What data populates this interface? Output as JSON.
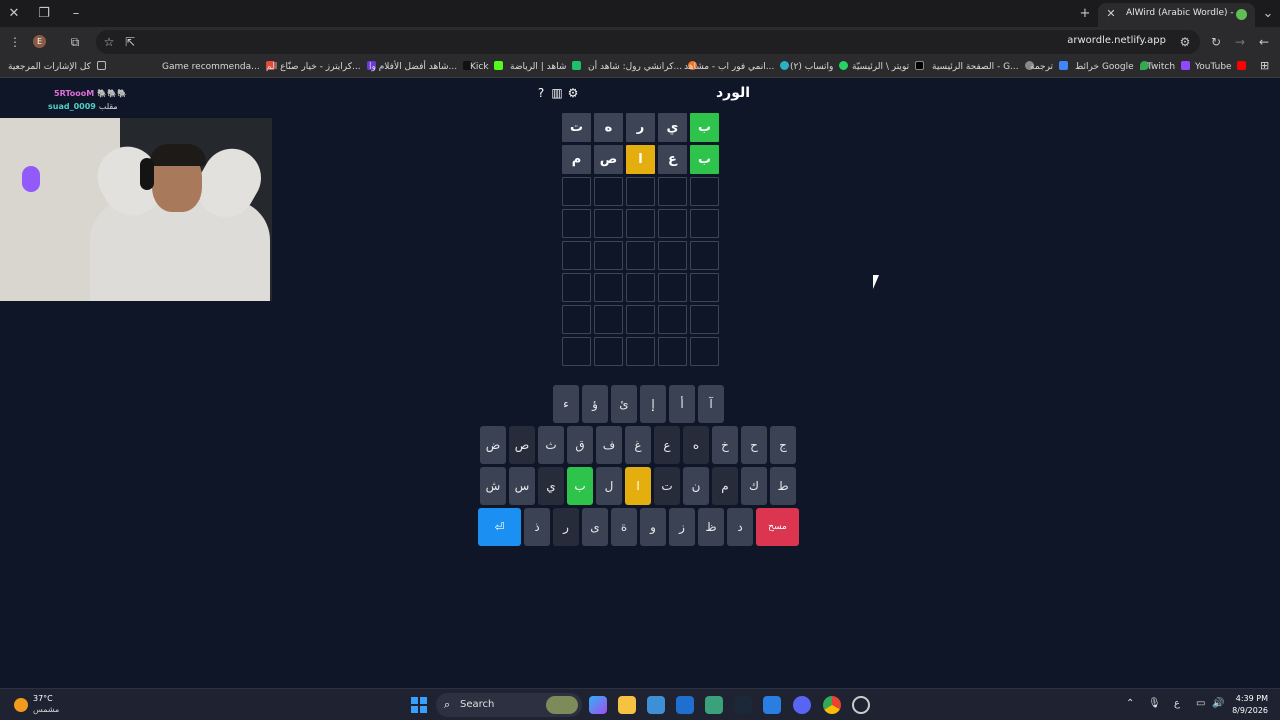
{
  "browser": {
    "tab_title": "AlWird (Arabic Wordle) - الورد",
    "url": "arwordle.netlify.app",
    "profile_initial": "E",
    "bookmarks": [
      "YouTube",
      "Twitch",
      "خرائط Google",
      "ترجمة",
      "الصفحة الرئيسية - G...",
      "تويتر \\ الرئيسيّة",
      "واتساب (٢)",
      "انمي فور اب - مشاهد...",
      "كرانشي رول: شاهد أن...",
      "شاهد | الرياضة",
      "Kick",
      "شاهد أفضل الأفلام وا...",
      "كرايترز - خيار صنّاع الم...",
      "Game recommenda...",
      "كل الإشارات المرجعية"
    ]
  },
  "stream": {
    "chat": [
      {
        "user": "5RToooM",
        "badges": "🐘🐘🐘"
      },
      {
        "user": "suad_0009",
        "tag": "مقلب"
      }
    ]
  },
  "game": {
    "title": "الورد",
    "board": [
      [
        {
          "l": "ب",
          "s": "correct"
        },
        {
          "l": "ي",
          "s": "absent"
        },
        {
          "l": "ر",
          "s": "absent"
        },
        {
          "l": "ه",
          "s": "absent"
        },
        {
          "l": "ت",
          "s": "absent"
        }
      ],
      [
        {
          "l": "ب",
          "s": "correct"
        },
        {
          "l": "ع",
          "s": "absent"
        },
        {
          "l": "ا",
          "s": "present"
        },
        {
          "l": "ص",
          "s": "absent"
        },
        {
          "l": "م",
          "s": "absent"
        }
      ],
      [
        {
          "l": "",
          "s": "empty"
        },
        {
          "l": "",
          "s": "empty"
        },
        {
          "l": "",
          "s": "empty"
        },
        {
          "l": "",
          "s": "empty"
        },
        {
          "l": "",
          "s": "empty"
        }
      ],
      [
        {
          "l": "",
          "s": "empty"
        },
        {
          "l": "",
          "s": "empty"
        },
        {
          "l": "",
          "s": "empty"
        },
        {
          "l": "",
          "s": "empty"
        },
        {
          "l": "",
          "s": "empty"
        }
      ],
      [
        {
          "l": "",
          "s": "empty"
        },
        {
          "l": "",
          "s": "empty"
        },
        {
          "l": "",
          "s": "empty"
        },
        {
          "l": "",
          "s": "empty"
        },
        {
          "l": "",
          "s": "empty"
        }
      ],
      [
        {
          "l": "",
          "s": "empty"
        },
        {
          "l": "",
          "s": "empty"
        },
        {
          "l": "",
          "s": "empty"
        },
        {
          "l": "",
          "s": "empty"
        },
        {
          "l": "",
          "s": "empty"
        }
      ],
      [
        {
          "l": "",
          "s": "empty"
        },
        {
          "l": "",
          "s": "empty"
        },
        {
          "l": "",
          "s": "empty"
        },
        {
          "l": "",
          "s": "empty"
        },
        {
          "l": "",
          "s": "empty"
        }
      ],
      [
        {
          "l": "",
          "s": "empty"
        },
        {
          "l": "",
          "s": "empty"
        },
        {
          "l": "",
          "s": "empty"
        },
        {
          "l": "",
          "s": "empty"
        },
        {
          "l": "",
          "s": "empty"
        }
      ]
    ],
    "keyboard": [
      [
        {
          "k": "آ"
        },
        {
          "k": "أ"
        },
        {
          "k": "إ"
        },
        {
          "k": "ئ"
        },
        {
          "k": "ؤ"
        },
        {
          "k": "ء"
        }
      ],
      [
        {
          "k": "ج"
        },
        {
          "k": "ح"
        },
        {
          "k": "خ"
        },
        {
          "k": "ه",
          "s": "used"
        },
        {
          "k": "ع",
          "s": "used"
        },
        {
          "k": "غ"
        },
        {
          "k": "ف"
        },
        {
          "k": "ق"
        },
        {
          "k": "ث"
        },
        {
          "k": "ص",
          "s": "used"
        },
        {
          "k": "ض"
        }
      ],
      [
        {
          "k": "ط"
        },
        {
          "k": "ك"
        },
        {
          "k": "م",
          "s": "used"
        },
        {
          "k": "ن"
        },
        {
          "k": "ت",
          "s": "used"
        },
        {
          "k": "ا",
          "s": "present"
        },
        {
          "k": "ل"
        },
        {
          "k": "ب",
          "s": "correct"
        },
        {
          "k": "ي",
          "s": "used"
        },
        {
          "k": "س"
        },
        {
          "k": "ش"
        }
      ],
      [
        {
          "k": "مسح",
          "s": "delete"
        },
        {
          "k": "د"
        },
        {
          "k": "ظ"
        },
        {
          "k": "ز"
        },
        {
          "k": "و"
        },
        {
          "k": "ة"
        },
        {
          "k": "ى"
        },
        {
          "k": "ر",
          "s": "used"
        },
        {
          "k": "ذ"
        },
        {
          "k": "⏎",
          "s": "enter"
        }
      ]
    ]
  },
  "taskbar": {
    "temperature": "37°C",
    "weather": "مشمس",
    "search_label": "Search",
    "input_lang": "ع",
    "time": "4:39 PM",
    "date": "8/9/2026"
  },
  "colors": {
    "correct": "#2ec44b",
    "present": "#e4ae0f",
    "enter": "#1b8ff2",
    "delete": "#dc3550"
  }
}
